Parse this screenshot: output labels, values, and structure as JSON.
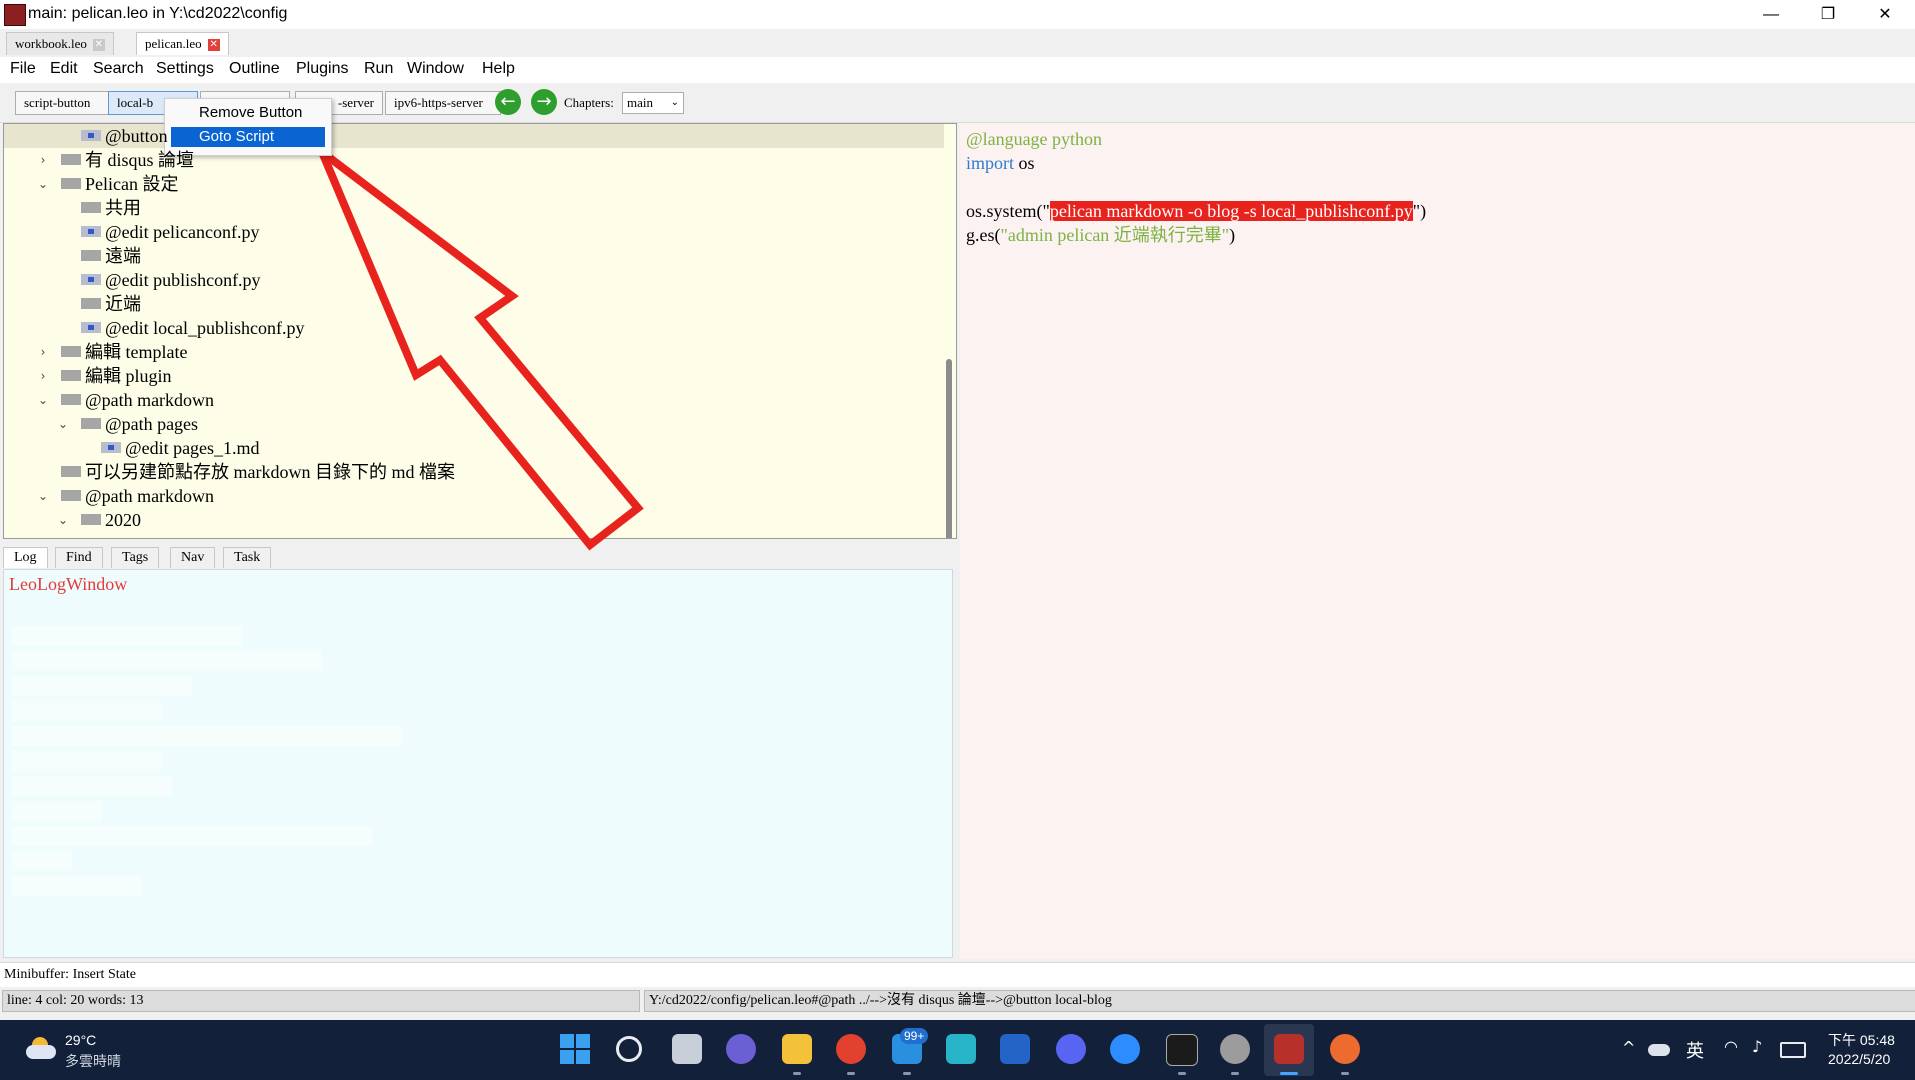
{
  "window": {
    "title": "main: pelican.leo in Y:\\cd2022\\config",
    "minimize": "—",
    "restore": "❐",
    "close": "✕"
  },
  "doc_tabs": [
    {
      "label": "workbook.leo",
      "close": "✕"
    },
    {
      "label": "pelican.leo",
      "close": "✕"
    }
  ],
  "menu": [
    "File",
    "Edit",
    "Search",
    "Settings",
    "Outline",
    "Plugins",
    "Run",
    "Window",
    "Help"
  ],
  "toolbar": {
    "buttons": [
      "script-button",
      "local-b",
      "",
      "-server",
      "ipv6-https-server"
    ],
    "back_icon": "←",
    "forward_icon": "→",
    "chapters_label": "Chapters:",
    "chapters_value": "main"
  },
  "context_menu": {
    "items": [
      "Remove Button",
      "Goto Script"
    ]
  },
  "outline": {
    "rows": [
      {
        "text": "@button",
        "arrow": "",
        "level": 2,
        "icon": "dot"
      },
      {
        "text": "有 disqus 論壇",
        "arrow": "›",
        "level": 1,
        "icon": "plain"
      },
      {
        "text": "Pelican 設定",
        "arrow": "⌄",
        "level": 1,
        "icon": "plain"
      },
      {
        "text": "共用",
        "arrow": "",
        "level": 2,
        "icon": "plain"
      },
      {
        "text": "@edit pelicanconf.py",
        "arrow": "",
        "level": 2,
        "icon": "dot"
      },
      {
        "text": "遠端",
        "arrow": "",
        "level": 2,
        "icon": "plain"
      },
      {
        "text": "@edit publishconf.py",
        "arrow": "",
        "level": 2,
        "icon": "dot"
      },
      {
        "text": "近端",
        "arrow": "",
        "level": 2,
        "icon": "plain"
      },
      {
        "text": "@edit local_publishconf.py",
        "arrow": "",
        "level": 2,
        "icon": "dot"
      },
      {
        "text": "編輯 template",
        "arrow": "›",
        "level": 1,
        "icon": "plain"
      },
      {
        "text": "編輯 plugin",
        "arrow": "›",
        "level": 1,
        "icon": "plain"
      },
      {
        "text": "@path markdown",
        "arrow": "⌄",
        "level": 1,
        "icon": "plain"
      },
      {
        "text": "@path pages",
        "arrow": "⌄",
        "level": 2,
        "icon": "plain"
      },
      {
        "text": "@edit pages_1.md",
        "arrow": "",
        "level": 3,
        "icon": "dot"
      },
      {
        "text": "可以另建節點存放 markdown 目錄下的 md 檔案",
        "arrow": "",
        "level": 1,
        "icon": "plain"
      },
      {
        "text": "@path markdown",
        "arrow": "⌄",
        "level": 1,
        "icon": "plain"
      },
      {
        "text": "2020",
        "arrow": "⌄",
        "level": 2,
        "icon": "plain"
      }
    ]
  },
  "body": {
    "line1": "@language python",
    "line2_kw": "import",
    "line2_rest": " os",
    "line4_pre": "os.system(\"",
    "line4_hl": "pelican markdown -o blog -s local_publishconf.py",
    "line4_post": "\")",
    "line5_pre": "g.es(",
    "line5_str": "\"admin pelican 近端執行完畢\"",
    "line5_post": ")"
  },
  "log_tabs": [
    "Log",
    "Find",
    "Tags",
    "Nav",
    "Task"
  ],
  "log": {
    "title": "LeoLogWindow"
  },
  "minibuffer": "Minibuffer:  Insert State",
  "status": {
    "left": "line: 4 col: 20  words: 13",
    "right": "Y:/cd2022/config/pelican.leo#@path ../-->沒有 disqus 論壇-->@button local-blog"
  },
  "taskbar": {
    "weather_temp": "29°C",
    "weather_desc": "多雲時晴",
    "mail_badge": "99+",
    "ime": "英",
    "time": "下午 05:48",
    "date": "2022/5/20"
  },
  "colors": {
    "outline_bg": "#fdfde8",
    "body_bg": "#fdf2f2",
    "log_bg": "#eefcfd",
    "highlight": "#e8231d",
    "arrow_annotation": "#e8231d",
    "taskbar_bg": "#12203a"
  }
}
